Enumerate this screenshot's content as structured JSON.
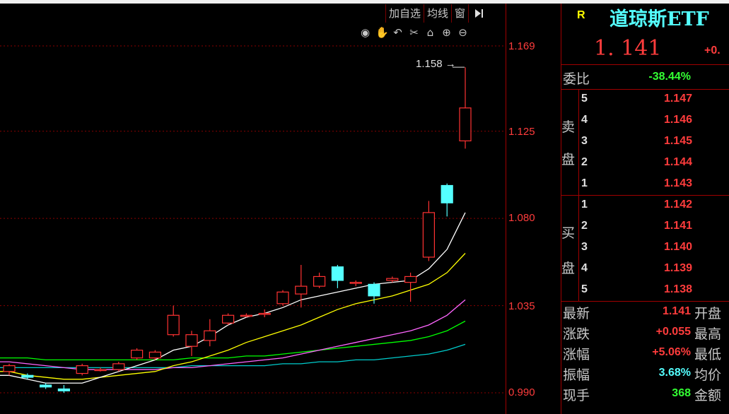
{
  "toolbar": {
    "add_watchlist": "加自选",
    "ma_lines": "均线",
    "window": "窗",
    "collapse_icon": "panel-collapse-icon"
  },
  "chart_icons": [
    "eye-icon",
    "hand-icon",
    "undo-icon",
    "scissors-icon",
    "lock-icon",
    "zoom-in-icon",
    "zoom-out-icon"
  ],
  "annotation": {
    "high_label": "1.158"
  },
  "chart_data": {
    "type": "candlestick",
    "y_ticks": [
      "1.169",
      "1.125",
      "1.080",
      "1.035",
      "0.990"
    ],
    "ylim": [
      0.985,
      1.169
    ],
    "colors": {
      "up": "#ff3232",
      "down": "#54ffff",
      "ma5": "#ffffff",
      "ma10": "#ffff00",
      "ma20": "#ff66ff",
      "ma30": "#00ff00",
      "ma60": "#00cccc"
    },
    "candles": [
      {
        "o": 1.001,
        "c": 1.004,
        "h": 1.005,
        "l": 0.999
      },
      {
        "o": 0.999,
        "c": 0.998,
        "h": 1.0,
        "l": 0.997
      },
      {
        "o": 0.994,
        "c": 0.993,
        "h": 0.995,
        "l": 0.992
      },
      {
        "o": 0.992,
        "c": 0.991,
        "h": 0.994,
        "l": 0.99
      },
      {
        "o": 1.0,
        "c": 1.004,
        "h": 1.005,
        "l": 0.999
      },
      {
        "o": 1.002,
        "c": 1.002,
        "h": 1.003,
        "l": 1.001
      },
      {
        "o": 1.002,
        "c": 1.005,
        "h": 1.006,
        "l": 1.001
      },
      {
        "o": 1.008,
        "c": 1.012,
        "h": 1.013,
        "l": 1.007
      },
      {
        "o": 1.008,
        "c": 1.011,
        "h": 1.012,
        "l": 1.007
      },
      {
        "o": 1.02,
        "c": 1.03,
        "h": 1.035,
        "l": 1.019
      },
      {
        "o": 1.014,
        "c": 1.02,
        "h": 1.022,
        "l": 1.009
      },
      {
        "o": 1.017,
        "c": 1.022,
        "h": 1.028,
        "l": 1.014
      },
      {
        "o": 1.026,
        "c": 1.03,
        "h": 1.031,
        "l": 1.025
      },
      {
        "o": 1.03,
        "c": 1.03,
        "h": 1.031,
        "l": 1.029
      },
      {
        "o": 1.031,
        "c": 1.031,
        "h": 1.033,
        "l": 1.029
      },
      {
        "o": 1.036,
        "c": 1.042,
        "h": 1.043,
        "l": 1.035
      },
      {
        "o": 1.041,
        "c": 1.045,
        "h": 1.056,
        "l": 1.034
      },
      {
        "o": 1.045,
        "c": 1.05,
        "h": 1.052,
        "l": 1.044
      },
      {
        "o": 1.055,
        "c": 1.048,
        "h": 1.056,
        "l": 1.044
      },
      {
        "o": 1.047,
        "c": 1.047,
        "h": 1.048,
        "l": 1.045
      },
      {
        "o": 1.046,
        "c": 1.04,
        "h": 1.047,
        "l": 1.036
      },
      {
        "o": 1.048,
        "c": 1.049,
        "h": 1.05,
        "l": 1.047
      },
      {
        "o": 1.047,
        "c": 1.05,
        "h": 1.052,
        "l": 1.037
      },
      {
        "o": 1.06,
        "c": 1.083,
        "h": 1.089,
        "l": 1.058
      },
      {
        "o": 1.097,
        "c": 1.088,
        "h": 1.098,
        "l": 1.081
      },
      {
        "o": 1.12,
        "c": 1.137,
        "h": 1.158,
        "l": 1.116
      }
    ],
    "ma5": [
      0.999,
      0.997,
      0.995,
      0.995,
      0.995,
      0.998,
      1.001,
      1.004,
      1.007,
      1.012,
      1.014,
      1.019,
      1.025,
      1.029,
      1.031,
      1.034,
      1.038,
      1.04,
      1.042,
      1.044,
      1.046,
      1.047,
      1.048,
      1.054,
      1.064,
      1.083
    ],
    "ma10": [
      1.001,
      0.999,
      0.998,
      0.997,
      0.997,
      0.998,
      0.999,
      1.0,
      1.001,
      1.004,
      1.006,
      1.009,
      1.012,
      1.016,
      1.019,
      1.022,
      1.025,
      1.029,
      1.033,
      1.036,
      1.038,
      1.04,
      1.043,
      1.046,
      1.052,
      1.062
    ],
    "ma20": [
      1.006,
      1.005,
      1.004,
      1.003,
      1.002,
      1.002,
      1.002,
      1.002,
      1.002,
      1.003,
      1.003,
      1.004,
      1.005,
      1.006,
      1.007,
      1.008,
      1.01,
      1.012,
      1.014,
      1.016,
      1.018,
      1.02,
      1.022,
      1.025,
      1.03,
      1.038
    ],
    "ma30": [
      1.008,
      1.008,
      1.007,
      1.007,
      1.007,
      1.007,
      1.007,
      1.007,
      1.007,
      1.007,
      1.008,
      1.008,
      1.008,
      1.009,
      1.009,
      1.01,
      1.011,
      1.012,
      1.013,
      1.014,
      1.015,
      1.016,
      1.017,
      1.019,
      1.022,
      1.027
    ],
    "ma60": [
      1.003,
      1.003,
      1.003,
      1.003,
      1.003,
      1.003,
      1.003,
      1.003,
      1.003,
      1.003,
      1.004,
      1.004,
      1.004,
      1.004,
      1.004,
      1.005,
      1.005,
      1.006,
      1.006,
      1.007,
      1.007,
      1.008,
      1.009,
      1.01,
      1.012,
      1.015
    ]
  },
  "quote": {
    "r_badge": "R",
    "name": "道琼斯ETF",
    "price": "1. 141",
    "change_short": "+0.",
    "weibi_label": "委比",
    "weibi_value": "-38.44%",
    "sell_label_1": "卖",
    "sell_label_2": "盘",
    "buy_label_1": "买",
    "buy_label_2": "盘",
    "sell": [
      {
        "level": "5",
        "price": "1.147"
      },
      {
        "level": "4",
        "price": "1.146"
      },
      {
        "level": "3",
        "price": "1.145"
      },
      {
        "level": "2",
        "price": "1.144"
      },
      {
        "level": "1",
        "price": "1.143"
      }
    ],
    "buy": [
      {
        "level": "1",
        "price": "1.142"
      },
      {
        "level": "2",
        "price": "1.141"
      },
      {
        "level": "3",
        "price": "1.140"
      },
      {
        "level": "4",
        "price": "1.139"
      },
      {
        "level": "5",
        "price": "1.138"
      }
    ],
    "stats": [
      {
        "label": "最新",
        "value": "1.141",
        "right": "开盘",
        "color": "#ff3c3c"
      },
      {
        "label": "涨跌",
        "value": "+0.055",
        "right": "最高",
        "color": "#ff3c3c"
      },
      {
        "label": "涨幅",
        "value": "+5.06%",
        "right": "最低",
        "color": "#ff3c3c"
      },
      {
        "label": "振幅",
        "value": "3.68%",
        "right": "均价",
        "color": "#54ffff"
      },
      {
        "label": "现手",
        "value": "368",
        "right": "金额",
        "color": "#33ff33"
      }
    ]
  }
}
